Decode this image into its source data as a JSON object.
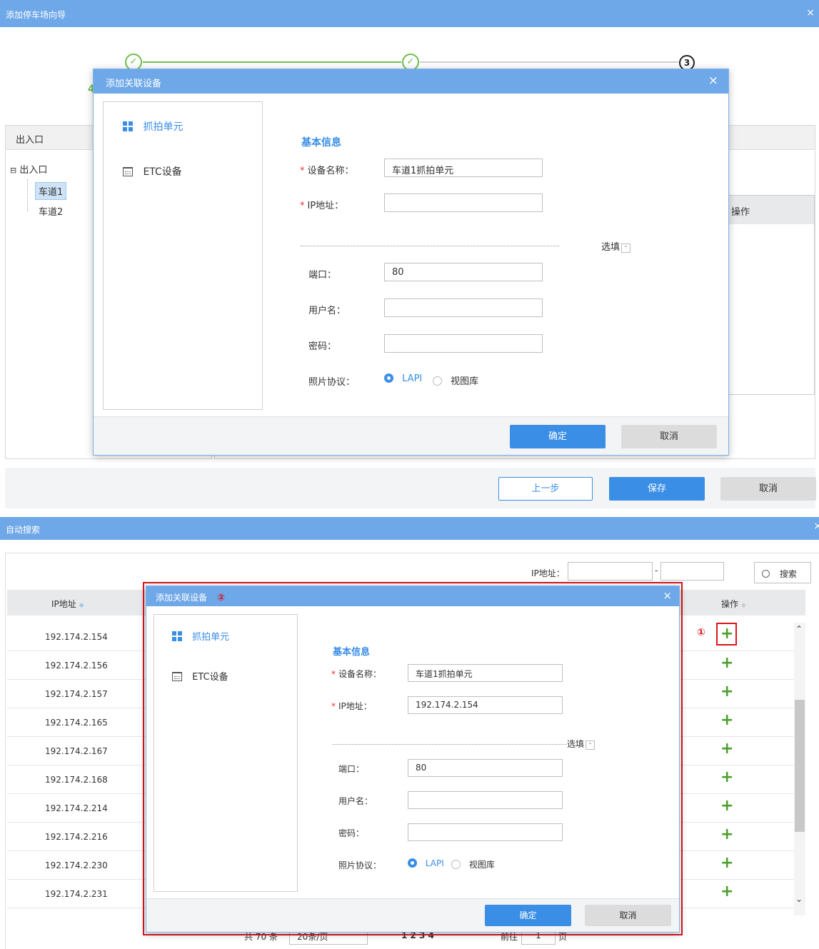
{
  "wizard": {
    "title": "添加停车场向导",
    "close": "×",
    "steps": [
      "✓",
      "✓",
      "3"
    ],
    "step_partial": "4",
    "left_panel": {
      "header": "出入口",
      "root": "出入口",
      "expand": "⊟",
      "items": [
        "车道1",
        "车道2"
      ]
    },
    "right_panel": {
      "col_op": "操作"
    },
    "footer": {
      "prev": "上一步",
      "save": "保存",
      "cancel": "取消"
    }
  },
  "modal1": {
    "title": "添加关联设备",
    "close": "×",
    "side_items": [
      "抓拍单元",
      "ETC设备"
    ],
    "section": "基本信息",
    "fields": {
      "name_label": "设备名称：",
      "name_value": "车道1抓拍单元",
      "ip_label": "IP地址：",
      "ip_value": "",
      "optional": "选填",
      "port_label": "端口：",
      "port_value": "80",
      "user_label": "用户名：",
      "user_value": "",
      "pwd_label": "密码：",
      "pwd_value": "",
      "proto_label": "照片协议：",
      "proto_opt1": "LAPI",
      "proto_opt2": "视图库"
    },
    "ok": "确定",
    "cancel": "取消"
  },
  "search": {
    "title": "自动搜索",
    "ip_label": "IP地址：",
    "range_sep": "-",
    "search_btn": "搜索",
    "col_ip": "IP地址",
    "col_op": "操作",
    "rows": [
      "192.174.2.154",
      "192.174.2.156",
      "192.174.2.157",
      "192.174.2.165",
      "192.174.2.167",
      "192.174.2.168",
      "192.174.2.214",
      "192.174.2.216",
      "192.174.2.230",
      "192.174.2.231"
    ],
    "plus": "+",
    "pager": {
      "total": "共 70 条",
      "per_page": "20条/页",
      "pages": "1  2  3  4",
      "goto": "前往",
      "page_input": "1",
      "page_unit": "页"
    },
    "callout1": "①",
    "callout2": "②"
  },
  "modal2": {
    "title": "添加关联设备",
    "close": "×",
    "side_items": [
      "抓拍单元",
      "ETC设备"
    ],
    "section": "基本信息",
    "fields": {
      "name_label": "设备名称：",
      "name_value": "车道1抓拍单元",
      "ip_label": "IP地址：",
      "ip_value": "192.174.2.154",
      "optional": "选填",
      "port_label": "端口：",
      "port_value": "80",
      "user_label": "用户名：",
      "user_value": "",
      "pwd_label": "密码：",
      "pwd_value": "",
      "proto_label": "照片协议：",
      "proto_opt1": "LAPI",
      "proto_opt2": "视图库"
    },
    "ok": "确定",
    "cancel": "取消"
  },
  "colors": {
    "header_blue": "#6fa8e8",
    "primary": "#3a8ee6",
    "step_green": "#6cc04a",
    "plus_green": "#4aa02c",
    "highlight_red": "#d9161c"
  }
}
